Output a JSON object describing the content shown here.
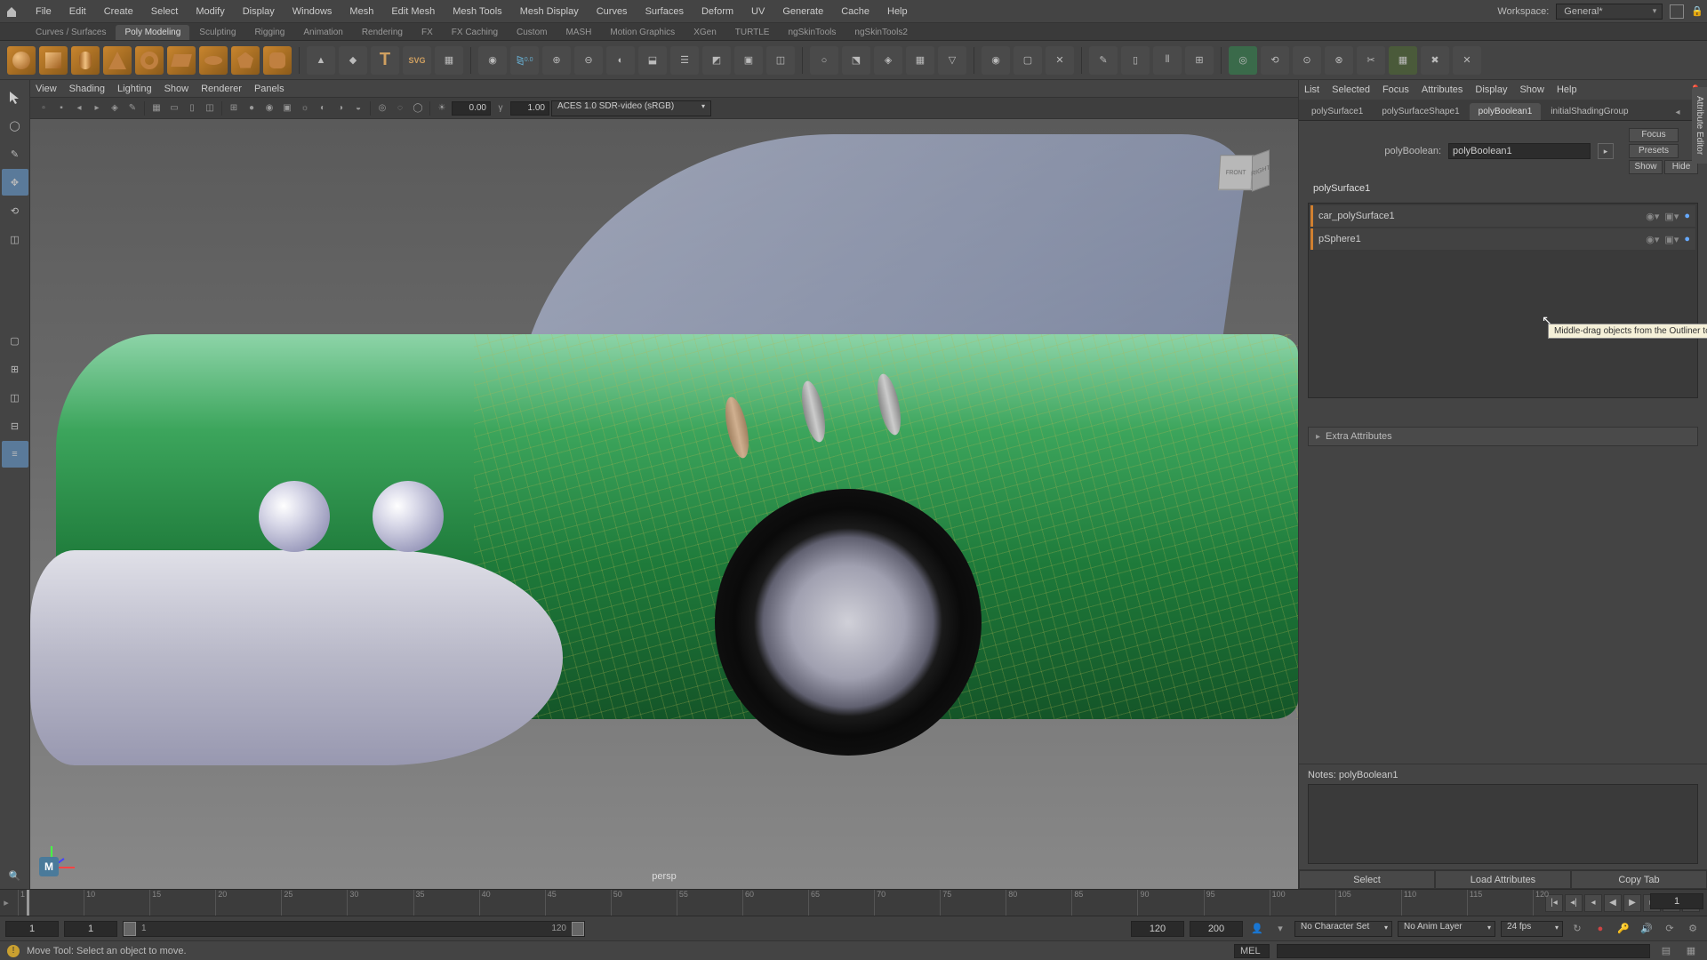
{
  "menubar": {
    "items": [
      "File",
      "Edit",
      "Create",
      "Select",
      "Modify",
      "Display",
      "Windows",
      "Mesh",
      "Edit Mesh",
      "Mesh Tools",
      "Mesh Display",
      "Curves",
      "Surfaces",
      "Deform",
      "UV",
      "Generate",
      "Cache",
      "Help"
    ],
    "workspace_label": "Workspace:",
    "workspace_value": "General*"
  },
  "shelf": {
    "tabs": [
      "Curves / Surfaces",
      "Poly Modeling",
      "Sculpting",
      "Rigging",
      "Animation",
      "Rendering",
      "FX",
      "FX Caching",
      "Custom",
      "MASH",
      "Motion Graphics",
      "XGen",
      "TURTLE",
      "ngSkinTools",
      "ngSkinTools2"
    ],
    "active_tab": 1
  },
  "viewport": {
    "menu": [
      "View",
      "Shading",
      "Lighting",
      "Show",
      "Renderer",
      "Panels"
    ],
    "gamma": "0.00",
    "exposure": "1.00",
    "colorspace": "ACES 1.0 SDR-video (sRGB)",
    "persp_label": "persp",
    "maya_badge": "M"
  },
  "attr_editor": {
    "menu": [
      "List",
      "Selected",
      "Focus",
      "Attributes",
      "Display",
      "Show",
      "Help"
    ],
    "tabs": [
      "polySurface1",
      "polySurfaceShape1",
      "polyBoolean1",
      "initialShadingGroup"
    ],
    "active_tab": 2,
    "node_type_label": "polyBoolean:",
    "node_name": "polyBoolean1",
    "buttons": {
      "focus": "Focus",
      "presets": "Presets",
      "show": "Show",
      "hide": "Hide"
    },
    "section_title": "polySurface1",
    "inputs": [
      {
        "name": "car_polySurface1"
      },
      {
        "name": "pSphere1"
      }
    ],
    "tooltip": "Middle-drag objects from the Outliner to ad",
    "extra_attrs": "Extra Attributes",
    "notes_label": "Notes:",
    "notes_node": "polyBoolean1",
    "bottom_buttons": [
      "Select",
      "Load Attributes",
      "Copy Tab"
    ],
    "side_tab": "Attribute Editor"
  },
  "timeline": {
    "ticks": [
      "1",
      "10",
      "15",
      "20",
      "25",
      "30",
      "35",
      "40",
      "45",
      "50",
      "55",
      "60",
      "65",
      "70",
      "75",
      "80",
      "85",
      "90",
      "95",
      "100",
      "105",
      "110",
      "115",
      "120"
    ],
    "current_frame": "1"
  },
  "range": {
    "start": "1",
    "playback_start": "1",
    "slider_value": "1",
    "playback_end": "120",
    "end": "120",
    "end2": "200",
    "charset": "No Character Set",
    "animlayer": "No Anim Layer",
    "fps": "24 fps"
  },
  "statusbar": {
    "message": "Move Tool: Select an object to move.",
    "cmd_lang": "MEL"
  }
}
